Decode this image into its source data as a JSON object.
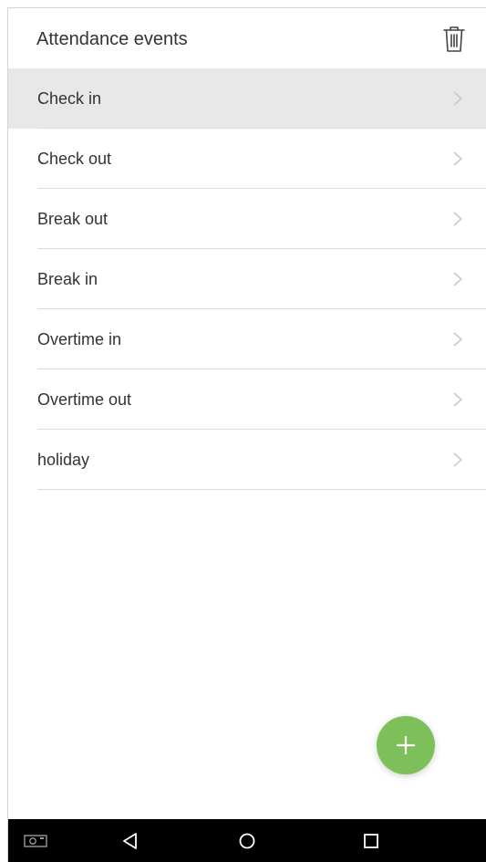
{
  "header": {
    "title": "Attendance events",
    "delete_icon": "trash-icon"
  },
  "events": [
    {
      "label": "Check in",
      "selected": true
    },
    {
      "label": "Check out",
      "selected": false
    },
    {
      "label": "Break out",
      "selected": false
    },
    {
      "label": "Break in",
      "selected": false
    },
    {
      "label": "Overtime in",
      "selected": false
    },
    {
      "label": "Overtime out",
      "selected": false
    },
    {
      "label": "holiday",
      "selected": false
    }
  ],
  "fab": {
    "icon": "plus-icon",
    "color": "#7dc05a"
  },
  "navbar": {
    "icons": [
      "screenshot-icon",
      "back-icon",
      "home-icon",
      "recents-icon"
    ]
  },
  "colors": {
    "selected_row": "#e8e8e8",
    "divider": "#dcdcdc",
    "text": "#333333",
    "navbar": "#000000"
  }
}
